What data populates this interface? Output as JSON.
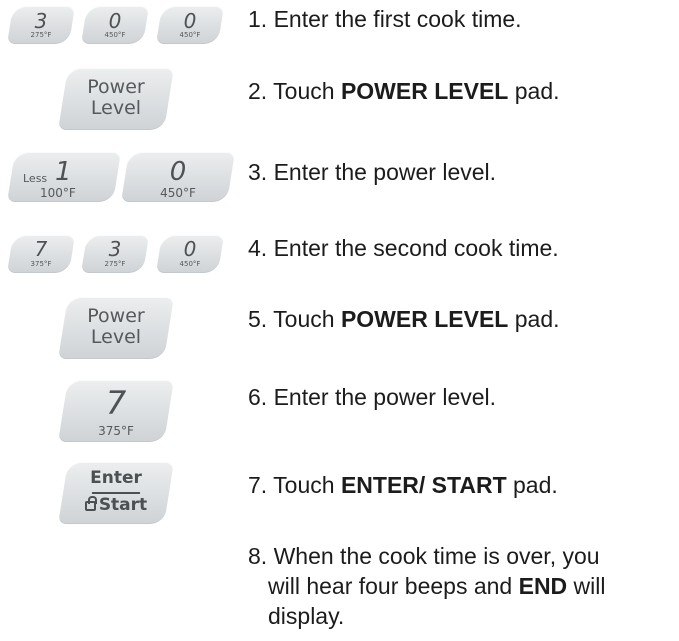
{
  "keypads": {
    "row1": [
      {
        "digit": "3",
        "temp": "275°F"
      },
      {
        "digit": "0",
        "temp": "450°F"
      },
      {
        "digit": "0",
        "temp": "450°F"
      }
    ],
    "power_level_1": {
      "line1": "Power",
      "line2": "Level"
    },
    "row3": {
      "less": {
        "word": "Less",
        "digit": "1",
        "temp": "100°F"
      },
      "zero": {
        "digit": "0",
        "temp": "450°F"
      }
    },
    "row4": [
      {
        "digit": "7",
        "temp": "375°F"
      },
      {
        "digit": "3",
        "temp": "275°F"
      },
      {
        "digit": "0",
        "temp": "450°F"
      }
    ],
    "power_level_2": {
      "line1": "Power",
      "line2": "Level"
    },
    "seven": {
      "digit": "7",
      "temp": "375°F"
    },
    "enter_start": {
      "top": "Enter",
      "bottom": "Start",
      "lock_icon": "lock-icon"
    }
  },
  "steps": [
    {
      "number": "1.",
      "pre": "Enter the first cook time.",
      "bold": "",
      "post": ""
    },
    {
      "number": "2.",
      "pre": "Touch ",
      "bold": "POWER LEVEL",
      "post": " pad."
    },
    {
      "number": "3.",
      "pre": "Enter the power level.",
      "bold": "",
      "post": ""
    },
    {
      "number": "4.",
      "pre": "Enter the second cook time.",
      "bold": "",
      "post": ""
    },
    {
      "number": "5.",
      "pre": "Touch ",
      "bold": "POWER LEVEL",
      "post": " pad."
    },
    {
      "number": "6.",
      "pre": "Enter the power level.",
      "bold": "",
      "post": ""
    },
    {
      "number": "7.",
      "pre": "Touch ",
      "bold": "ENTER/ START",
      "post": " pad."
    },
    {
      "number": "8.",
      "line1": "When the cook time is over, you",
      "line2_pre": "will hear four beeps and ",
      "line2_bold": "END",
      "line2_post": " will",
      "line3": "display."
    }
  ]
}
